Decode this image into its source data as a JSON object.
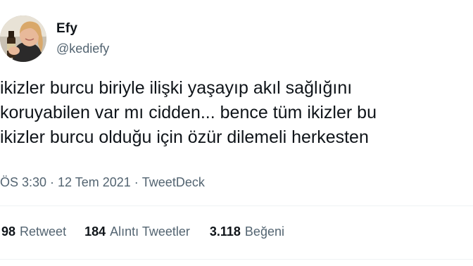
{
  "author": {
    "display_name": "Efy",
    "handle": "@kediefy"
  },
  "tweet": {
    "lines": [
      "ikizler burcu biriyle ilişki yaşayıp akıl sağlığını",
      "koruyabilen var mı cidden... bence tüm ikizler bu",
      "ikizler burcu olduğu için özür dilemeli herkesten"
    ]
  },
  "meta": {
    "time": "ÖS 3:30",
    "separator": "·",
    "date": "12 Tem 2021",
    "source": "TweetDeck"
  },
  "stats": {
    "retweets": {
      "count": "98",
      "label": "Retweet"
    },
    "quotes": {
      "count": "184",
      "label": "Alıntı Tweetler"
    },
    "likes": {
      "count": "3.118",
      "label": "Beğeni"
    }
  },
  "colors": {
    "text_primary": "#0f1419",
    "text_secondary": "#536471",
    "divider": "#eff3f4"
  }
}
